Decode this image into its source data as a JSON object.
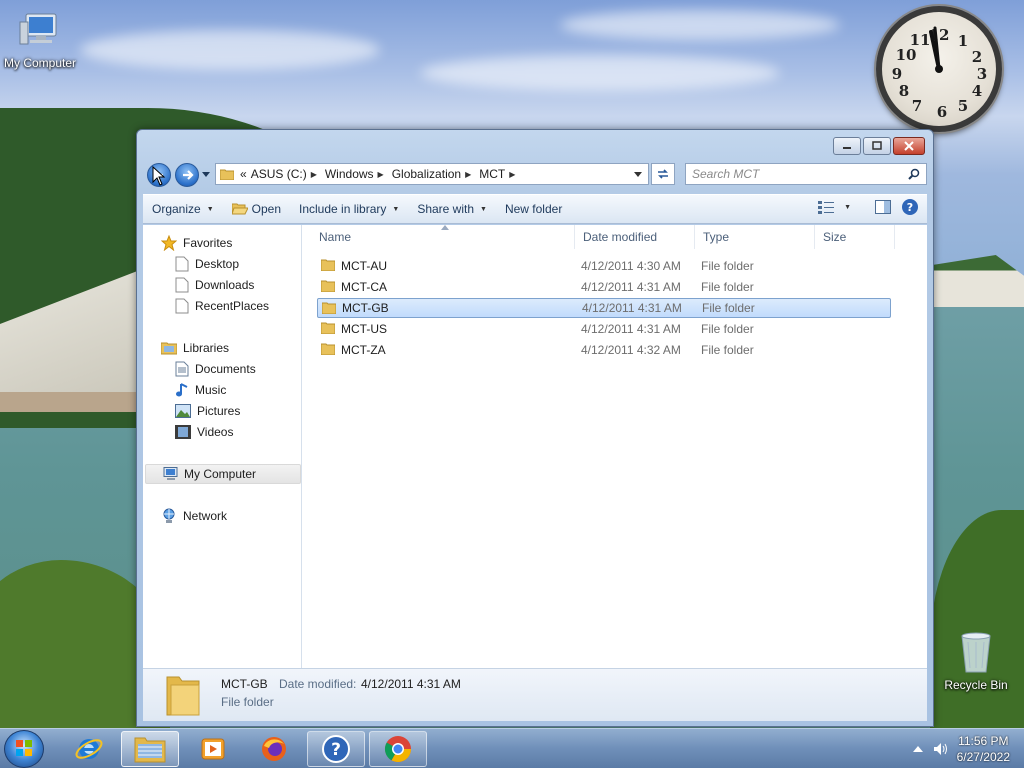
{
  "desktop": {
    "icons": [
      {
        "label": "My Computer"
      },
      {
        "label": "Recycle Bin"
      }
    ]
  },
  "window": {
    "address": {
      "overflow": "«",
      "crumbs": [
        "ASUS (C:)",
        "Windows",
        "Globalization",
        "MCT"
      ]
    },
    "search_placeholder": "Search MCT",
    "toolbar": {
      "organize": "Organize",
      "open": "Open",
      "include_in_library": "Include in library",
      "share_with": "Share with",
      "new_folder": "New folder"
    },
    "navpane": {
      "favorites": "Favorites",
      "favorites_items": [
        "Desktop",
        "Downloads",
        "RecentPlaces"
      ],
      "libraries": "Libraries",
      "libraries_items": [
        "Documents",
        "Music",
        "Pictures",
        "Videos"
      ],
      "computer": "My Computer",
      "network": "Network"
    },
    "columns": {
      "name": "Name",
      "date": "Date modified",
      "type": "Type",
      "size": "Size"
    },
    "files": [
      {
        "name": "MCT-AU",
        "date": "4/12/2011 4:30 AM",
        "type": "File folder"
      },
      {
        "name": "MCT-CA",
        "date": "4/12/2011 4:31 AM",
        "type": "File folder"
      },
      {
        "name": "MCT-GB",
        "date": "4/12/2011 4:31 AM",
        "type": "File folder"
      },
      {
        "name": "MCT-US",
        "date": "4/12/2011 4:31 AM",
        "type": "File folder"
      },
      {
        "name": "MCT-ZA",
        "date": "4/12/2011 4:32 AM",
        "type": "File folder"
      }
    ],
    "selected_index": 2,
    "details": {
      "name": "MCT-GB",
      "date_label": "Date modified:",
      "date_value": "4/12/2011 4:31 AM",
      "type": "File folder"
    }
  },
  "taskbar": {
    "apps": [
      "start-orb",
      "internet-explorer-icon",
      "windows-explorer-icon",
      "media-player-icon",
      "firefox-icon",
      "help-icon",
      "chrome-icon"
    ],
    "time": "11:56 PM",
    "date": "6/27/2022"
  },
  "colors": {
    "selection": "#cce4fc",
    "window_frame": "#b4cbe6",
    "folder": "#e8c15a"
  }
}
